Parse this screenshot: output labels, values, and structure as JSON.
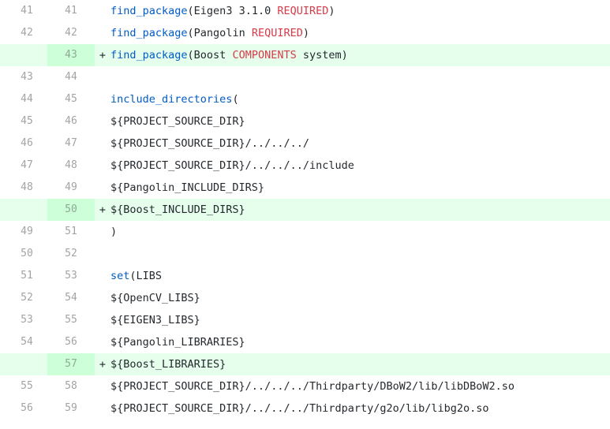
{
  "colors": {
    "added_row_bg": "#e6ffed",
    "added_gutter_bg": "#cdffd8",
    "function": "#005cc5",
    "keyword": "#d73a49",
    "text": "#24292e",
    "line_number": "#a3a3a3"
  },
  "lines": [
    {
      "old": "41",
      "new": "41",
      "type": "ctx",
      "marker": "",
      "tokens": [
        {
          "t": "find_package",
          "c": "fn"
        },
        {
          "t": "(Eigen3 3.1.0 ",
          "c": ""
        },
        {
          "t": "REQUIRED",
          "c": "kw"
        },
        {
          "t": ")",
          "c": ""
        }
      ]
    },
    {
      "old": "42",
      "new": "42",
      "type": "ctx",
      "marker": "",
      "tokens": [
        {
          "t": "find_package",
          "c": "fn"
        },
        {
          "t": "(Pangolin ",
          "c": ""
        },
        {
          "t": "REQUIRED",
          "c": "kw"
        },
        {
          "t": ")",
          "c": ""
        }
      ]
    },
    {
      "old": "",
      "new": "43",
      "type": "add",
      "marker": "+",
      "tokens": [
        {
          "t": "find_package",
          "c": "fn"
        },
        {
          "t": "(Boost ",
          "c": ""
        },
        {
          "t": "COMPONENTS",
          "c": "kw"
        },
        {
          "t": " system)",
          "c": ""
        }
      ]
    },
    {
      "old": "43",
      "new": "44",
      "type": "ctx",
      "marker": "",
      "tokens": []
    },
    {
      "old": "44",
      "new": "45",
      "type": "ctx",
      "marker": "",
      "tokens": [
        {
          "t": "include_directories",
          "c": "fn"
        },
        {
          "t": "(",
          "c": ""
        }
      ]
    },
    {
      "old": "45",
      "new": "46",
      "type": "ctx",
      "marker": "",
      "tokens": [
        {
          "t": "${PROJECT_SOURCE_DIR}",
          "c": ""
        }
      ]
    },
    {
      "old": "46",
      "new": "47",
      "type": "ctx",
      "marker": "",
      "tokens": [
        {
          "t": "${PROJECT_SOURCE_DIR}/../../../",
          "c": ""
        }
      ]
    },
    {
      "old": "47",
      "new": "48",
      "type": "ctx",
      "marker": "",
      "tokens": [
        {
          "t": "${PROJECT_SOURCE_DIR}/../../../include",
          "c": ""
        }
      ]
    },
    {
      "old": "48",
      "new": "49",
      "type": "ctx",
      "marker": "",
      "tokens": [
        {
          "t": "${Pangolin_INCLUDE_DIRS}",
          "c": ""
        }
      ]
    },
    {
      "old": "",
      "new": "50",
      "type": "add",
      "marker": "+",
      "tokens": [
        {
          "t": "${Boost_INCLUDE_DIRS}",
          "c": ""
        }
      ]
    },
    {
      "old": "49",
      "new": "51",
      "type": "ctx",
      "marker": "",
      "tokens": [
        {
          "t": ")",
          "c": ""
        }
      ]
    },
    {
      "old": "50",
      "new": "52",
      "type": "ctx",
      "marker": "",
      "tokens": []
    },
    {
      "old": "51",
      "new": "53",
      "type": "ctx",
      "marker": "",
      "tokens": [
        {
          "t": "set",
          "c": "fn"
        },
        {
          "t": "(LIBS",
          "c": ""
        }
      ]
    },
    {
      "old": "52",
      "new": "54",
      "type": "ctx",
      "marker": "",
      "tokens": [
        {
          "t": "${OpenCV_LIBS}",
          "c": ""
        }
      ]
    },
    {
      "old": "53",
      "new": "55",
      "type": "ctx",
      "marker": "",
      "tokens": [
        {
          "t": "${EIGEN3_LIBS}",
          "c": ""
        }
      ]
    },
    {
      "old": "54",
      "new": "56",
      "type": "ctx",
      "marker": "",
      "tokens": [
        {
          "t": "${Pangolin_LIBRARIES}",
          "c": ""
        }
      ]
    },
    {
      "old": "",
      "new": "57",
      "type": "add",
      "marker": "+",
      "tokens": [
        {
          "t": "${Boost_LIBRARIES}",
          "c": ""
        }
      ]
    },
    {
      "old": "55",
      "new": "58",
      "type": "ctx",
      "marker": "",
      "tokens": [
        {
          "t": "${PROJECT_SOURCE_DIR}/../../../Thirdparty/DBoW2/lib/libDBoW2.so",
          "c": ""
        }
      ]
    },
    {
      "old": "56",
      "new": "59",
      "type": "ctx",
      "marker": "",
      "tokens": [
        {
          "t": "${PROJECT_SOURCE_DIR}/../../../Thirdparty/g2o/lib/libg2o.so",
          "c": ""
        }
      ]
    }
  ]
}
